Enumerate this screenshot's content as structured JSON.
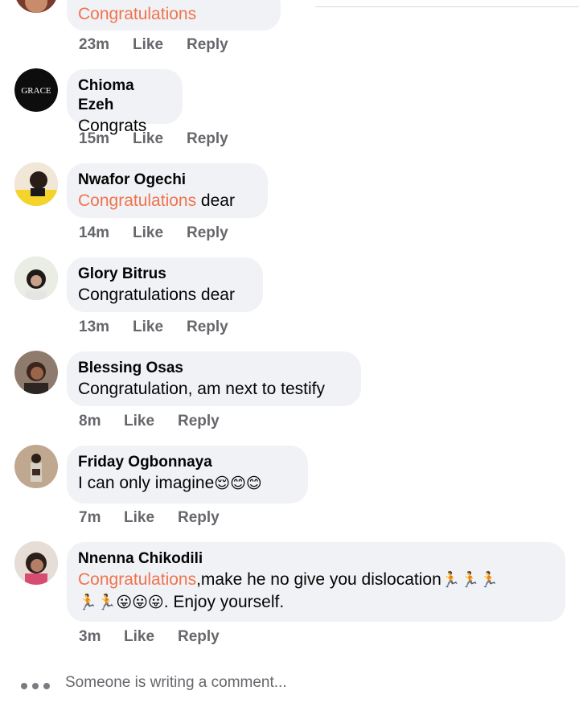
{
  "comments": [
    {
      "author": "",
      "text_hl": "Congratulations",
      "text": "",
      "time": "23m",
      "like": "Like",
      "reply": "Reply"
    },
    {
      "author": "Chioma Ezeh",
      "avatar_text": "GRACE",
      "text_hl": "",
      "text": "Congrats",
      "time": "15m",
      "like": "Like",
      "reply": "Reply"
    },
    {
      "author": "Nwafor Ogechi",
      "text_hl": "Congratulations",
      "text": " dear",
      "time": "14m",
      "like": "Like",
      "reply": "Reply"
    },
    {
      "author": "Glory Bitrus",
      "text_hl": "",
      "text": "Congratulations dear",
      "time": "13m",
      "like": "Like",
      "reply": "Reply"
    },
    {
      "author": "Blessing Osas",
      "text_hl": "",
      "text": "Congratulation, am next to testify",
      "time": "8m",
      "like": "Like",
      "reply": "Reply"
    },
    {
      "author": "Friday Ogbonnaya",
      "text_hl": "",
      "text": "I can only imagine",
      "emojis": "😌😊😊",
      "time": "7m",
      "like": "Like",
      "reply": "Reply"
    },
    {
      "author": "Nnenna Chikodili",
      "text_hl": "Congratulations",
      "text": ",make he no give you  dislocation",
      "emojis_line1": "🏃🏃🏃",
      "emojis_line2": "🏃🏃😛😛😛",
      "text_line2": ". Enjoy yourself.",
      "time": "3m",
      "like": "Like",
      "reply": "Reply"
    }
  ],
  "typing_indicator": "Someone is writing a comment...",
  "colors": {
    "highlight": "#f0734f",
    "bubble": "#f0f2f5",
    "meta": "#65676b"
  }
}
